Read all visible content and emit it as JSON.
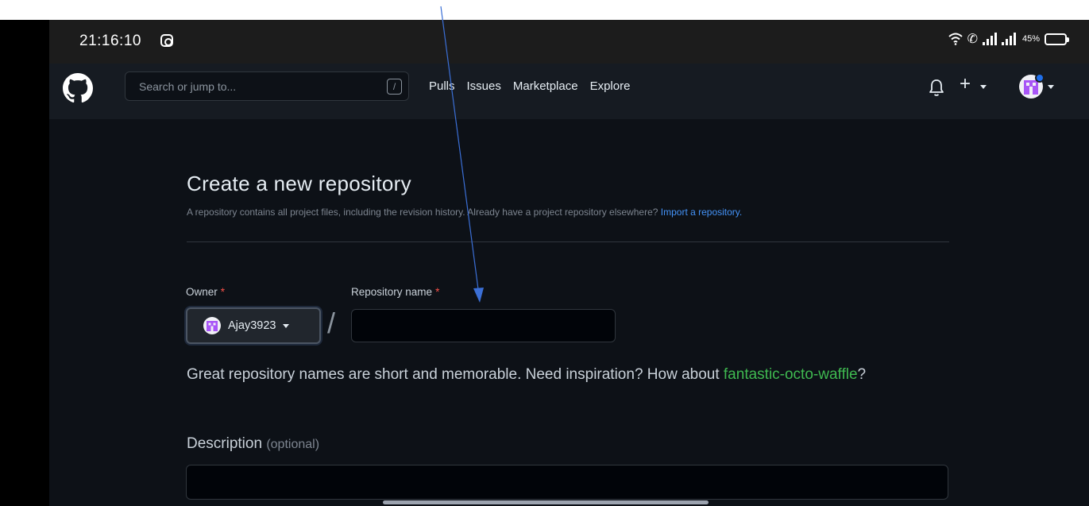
{
  "status_bar": {
    "time": "21:16:10",
    "battery_pct": "45%",
    "battery_level": 0.45,
    "icons": [
      "instagram-icon",
      "wifi-icon",
      "call-icon",
      "signal-icon",
      "battery-icon"
    ]
  },
  "header": {
    "search_placeholder": "Search or jump to...",
    "search_key": "/",
    "nav": [
      {
        "label": "Pulls"
      },
      {
        "label": "Issues"
      },
      {
        "label": "Marketplace"
      },
      {
        "label": "Explore"
      }
    ],
    "plus": "+"
  },
  "page": {
    "title": "Create a new repository",
    "subtitle": "A repository contains all project files, including the revision history. Already have a project repository elsewhere?",
    "import_link": "Import a repository."
  },
  "form": {
    "owner_label": "Owner",
    "required_mark": "*",
    "owner_name": "Ajay3923",
    "separator": "/",
    "repo_name_label": "Repository name",
    "repo_name_value": "",
    "hint_text": "Great repository names are short and memorable. Need inspiration? How about",
    "hint_suggestion": "fantastic-octo-waffle",
    "hint_end": "?",
    "description_label": "Description",
    "description_optional": "(optional)",
    "description_value": ""
  },
  "colors": {
    "background": "#0d1117",
    "header": "#161b22",
    "link": "#4493f8",
    "suggestion": "#3fb950",
    "required": "#f85149",
    "annotation_arrow": "#3b6fd6"
  }
}
